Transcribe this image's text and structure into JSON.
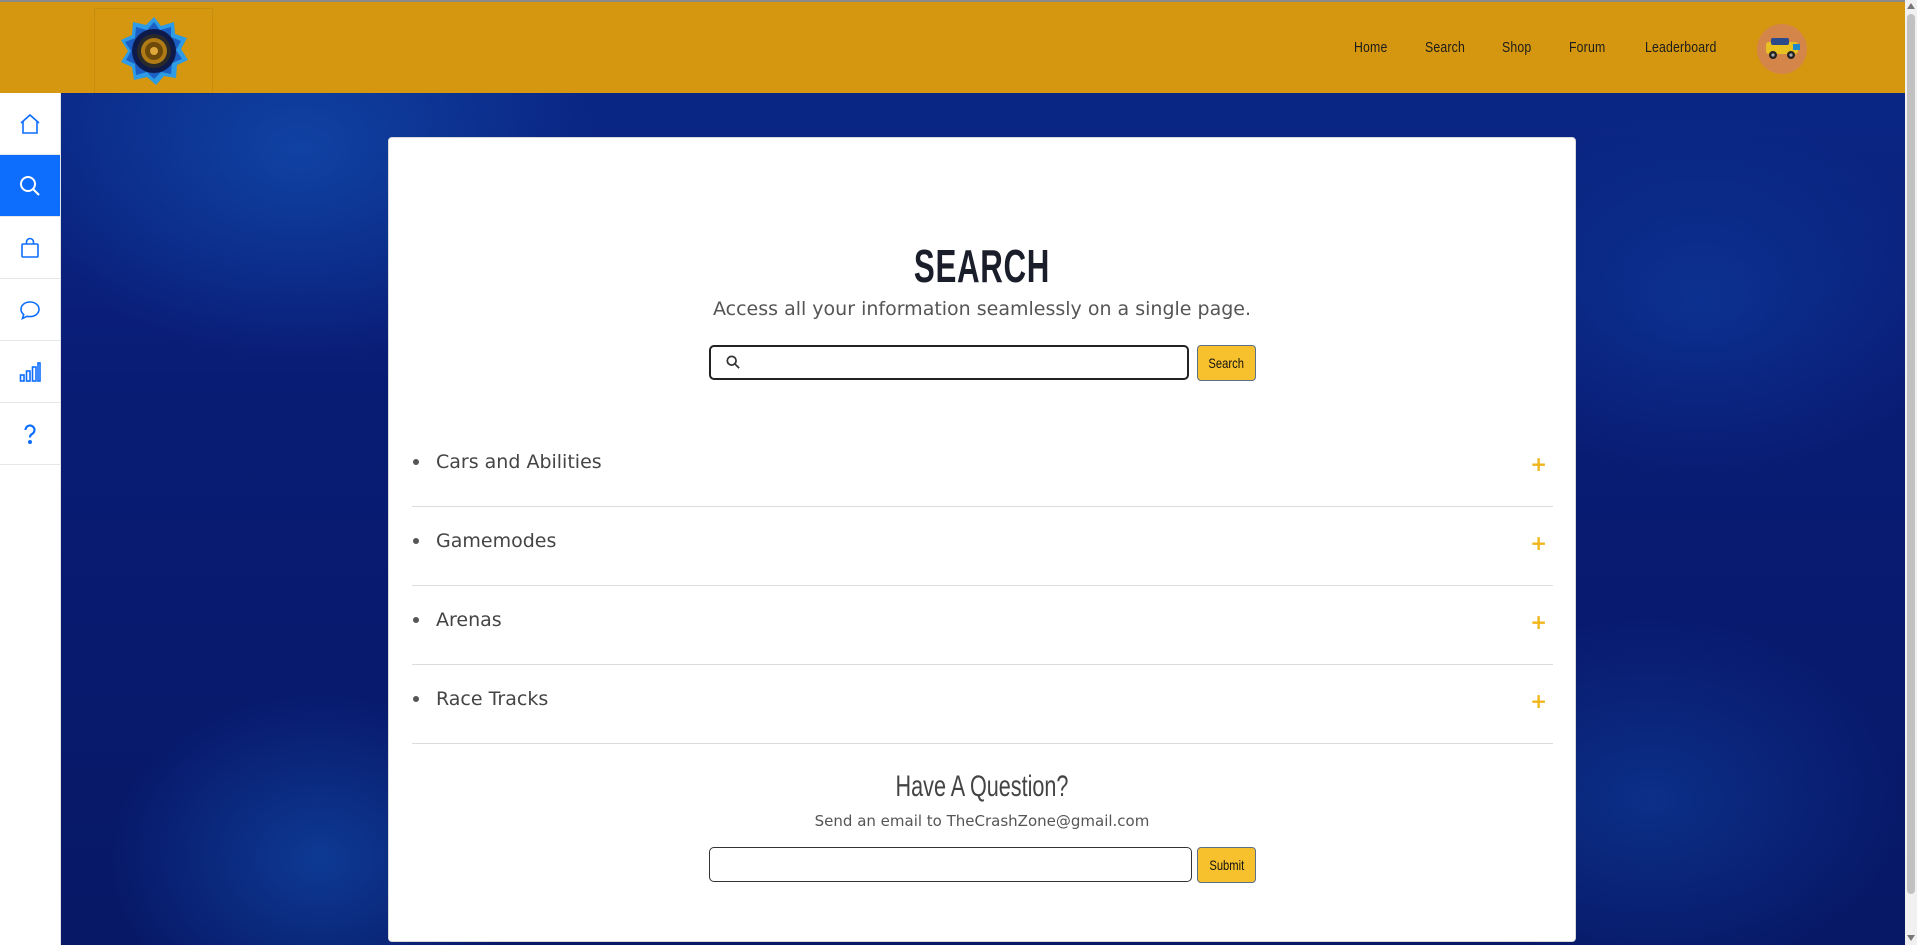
{
  "header": {
    "logo": "site-logo",
    "nav": [
      {
        "label": "Home"
      },
      {
        "label": "Search"
      },
      {
        "label": "Shop"
      },
      {
        "label": "Forum"
      },
      {
        "label": "Leaderboard"
      }
    ],
    "avatar": "car-avatar"
  },
  "sidebar": {
    "items": [
      {
        "icon": "home-icon",
        "active": false
      },
      {
        "icon": "search-icon",
        "active": true
      },
      {
        "icon": "shopping-bag-icon",
        "active": false
      },
      {
        "icon": "chat-bubble-icon",
        "active": false
      },
      {
        "icon": "bar-chart-icon",
        "active": false
      },
      {
        "icon": "question-icon",
        "active": false
      }
    ]
  },
  "main": {
    "title": "SEARCH",
    "subtitle": "Access all your information seamlessly on a single page.",
    "search": {
      "placeholder": "",
      "value": "",
      "button": "Search"
    },
    "accordion": [
      {
        "label": "Cars and Abilities",
        "toggle": "+"
      },
      {
        "label": "Gamemodes",
        "toggle": "+"
      },
      {
        "label": "Arenas",
        "toggle": "+"
      },
      {
        "label": "Race Tracks",
        "toggle": "+"
      }
    ],
    "question": {
      "heading": "Have A Question?",
      "note": "Send an email to TheCrashZone@gmail.com",
      "input_value": "",
      "button": "Submit"
    }
  },
  "colors": {
    "header": "#d4970f",
    "accent_blue": "#0d6efd",
    "button_yellow": "#f7c12d",
    "plus_yellow": "#f0b51a"
  }
}
